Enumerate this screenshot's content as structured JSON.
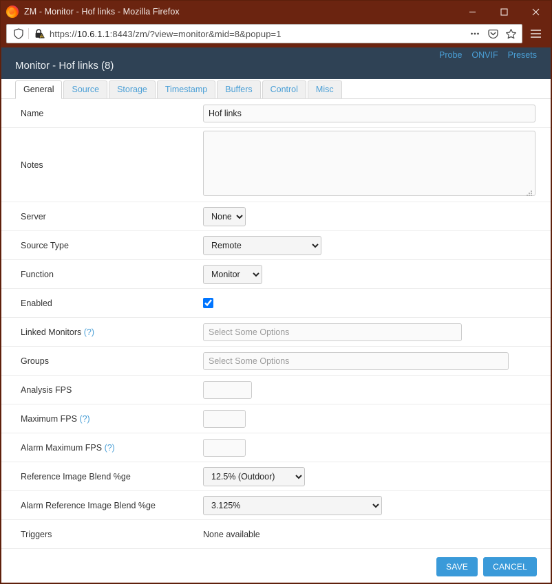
{
  "browser": {
    "window_title": "ZM - Monitor - Hof links - Mozilla Firefox",
    "url_scheme": "https://",
    "url_host": "10.6.1.1",
    "url_rest": ":8443/zm/?view=monitor&mid=8&popup=1",
    "minimize_label": "Minimize",
    "maximize_label": "Maximize",
    "close_label": "Close",
    "page_actions_label": "Page actions",
    "pocket_label": "Save to Pocket",
    "bookmark_label": "Bookmark this page",
    "menu_label": "Open application menu"
  },
  "header": {
    "title": "Monitor - Hof links (8)",
    "links": [
      {
        "label": "Probe"
      },
      {
        "label": "ONVIF"
      },
      {
        "label": "Presets"
      }
    ],
    "bg_color": "#2f4255",
    "link_color": "#4a9fd6"
  },
  "tabs": [
    {
      "label": "General",
      "active": true
    },
    {
      "label": "Source",
      "active": false
    },
    {
      "label": "Storage",
      "active": false
    },
    {
      "label": "Timestamp",
      "active": false
    },
    {
      "label": "Buffers",
      "active": false
    },
    {
      "label": "Control",
      "active": false
    },
    {
      "label": "Misc",
      "active": false
    }
  ],
  "form": {
    "name": {
      "label": "Name",
      "value": "Hof links"
    },
    "notes": {
      "label": "Notes",
      "value": ""
    },
    "server": {
      "label": "Server",
      "value": "None"
    },
    "source_type": {
      "label": "Source Type",
      "value": "Remote"
    },
    "function": {
      "label": "Function",
      "value": "Monitor"
    },
    "enabled": {
      "label": "Enabled",
      "checked": true
    },
    "linked_monitors": {
      "label": "Linked Monitors",
      "help": "(?)",
      "value": "",
      "placeholder": "Select Some Options"
    },
    "groups": {
      "label": "Groups",
      "value": "",
      "placeholder": "Select Some Options"
    },
    "analysis_fps": {
      "label": "Analysis FPS",
      "value": ""
    },
    "maximum_fps": {
      "label": "Maximum FPS",
      "help": "(?)",
      "value": ""
    },
    "alarm_maximum_fps": {
      "label": "Alarm Maximum FPS",
      "help": "(?)",
      "value": ""
    },
    "reference_blend": {
      "label": "Reference Image Blend %ge",
      "value": "12.5% (Outdoor)"
    },
    "alarm_reference_blend": {
      "label": "Alarm Reference Image Blend %ge",
      "value": "3.125%"
    },
    "triggers": {
      "label": "Triggers",
      "value": "None available"
    }
  },
  "actions": {
    "save_label": "SAVE",
    "cancel_label": "CANCEL",
    "button_color": "#3a9ad9"
  }
}
